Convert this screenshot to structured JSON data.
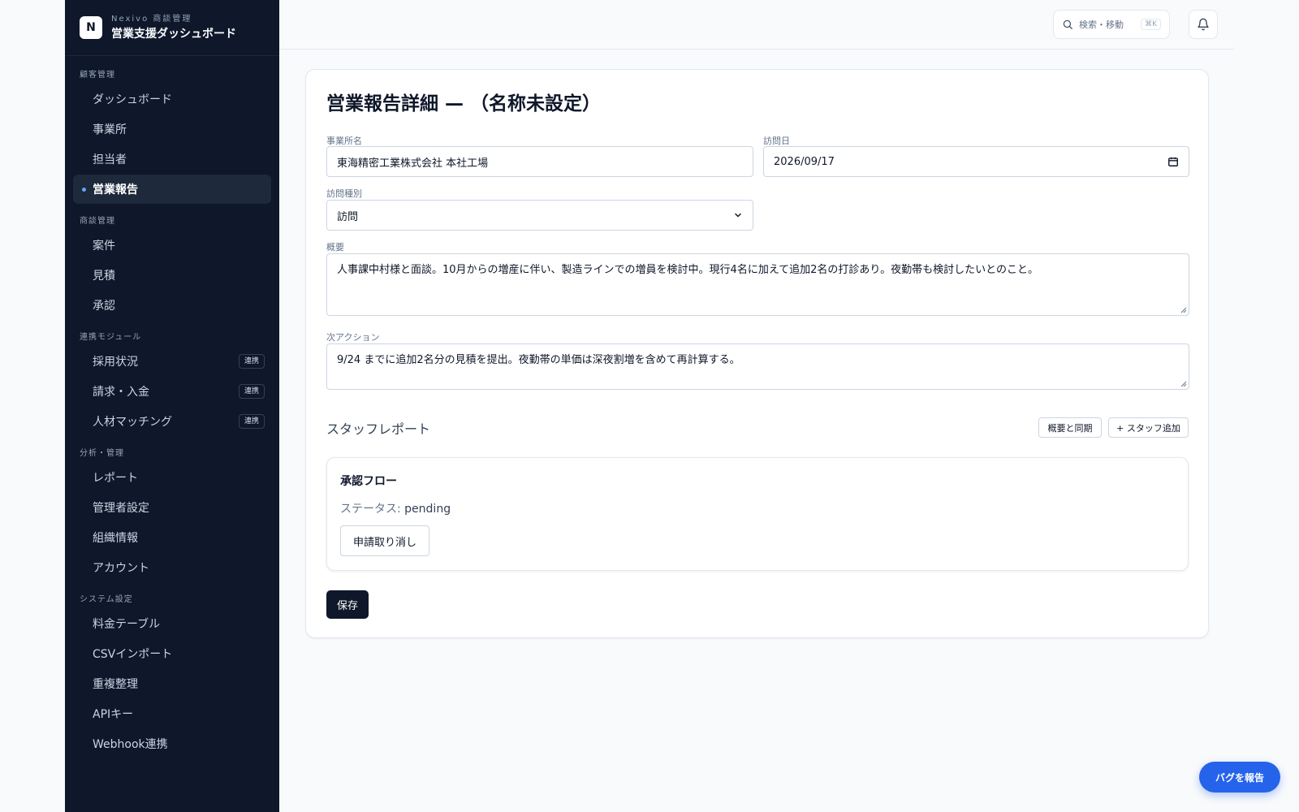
{
  "brand": {
    "logo": "N",
    "subtitle": "Nexivo 商談管理",
    "title": "営業支援ダッシュボード"
  },
  "sidebar": {
    "groups": [
      {
        "label": "顧客管理",
        "items": [
          {
            "label": "ダッシュボード"
          },
          {
            "label": "事業所"
          },
          {
            "label": "担当者"
          },
          {
            "label": "営業報告",
            "active": true
          }
        ]
      },
      {
        "label": "商談管理",
        "items": [
          {
            "label": "案件"
          },
          {
            "label": "見積"
          },
          {
            "label": "承認"
          }
        ]
      },
      {
        "label": "連携モジュール",
        "items": [
          {
            "label": "採用状況",
            "badge": "連携"
          },
          {
            "label": "請求・入金",
            "badge": "連携"
          },
          {
            "label": "人材マッチング",
            "badge": "連携"
          }
        ]
      },
      {
        "label": "分析・管理",
        "items": [
          {
            "label": "レポート"
          },
          {
            "label": "管理者設定"
          },
          {
            "label": "組織情報"
          },
          {
            "label": "アカウント"
          }
        ]
      },
      {
        "label": "システム設定",
        "items": [
          {
            "label": "料金テーブル"
          },
          {
            "label": "CSVインポート"
          },
          {
            "label": "重複整理"
          },
          {
            "label": "APIキー"
          },
          {
            "label": "Webhook連携"
          }
        ]
      }
    ]
  },
  "topbar": {
    "search_label": "検索・移動",
    "search_shortcut": "⌘K"
  },
  "form": {
    "title": "営業報告詳細 — （名称未設定）",
    "office_label": "事業所名",
    "office_value": "東海精密工業株式会社 本社工場",
    "visit_date_label": "訪問日",
    "visit_date_value": "2026/09/17",
    "visit_type_label": "訪問種別",
    "visit_type_value": "訪問",
    "summary_label": "概要",
    "summary_value": "人事課中村様と面談。10月からの増産に伴い、製造ラインでの増員を検討中。現行4名に加えて追加2名の打診あり。夜勤帯も検討したいとのこと。",
    "next_action_label": "次アクション",
    "next_action_value": "9/24 までに追加2名分の見積を提出。夜勤帯の単価は深夜割増を含めて再計算する。"
  },
  "staff_report": {
    "title": "スタッフレポート",
    "sync_button": "概要と同期",
    "add_button": "+ スタッフ追加"
  },
  "approval": {
    "title": "承認フロー",
    "status_label": "ステータス: ",
    "status_value": "pending",
    "cancel_button": "申請取り消し"
  },
  "save_button": "保存",
  "bug_report_button": "バグを報告",
  "colors": {
    "sidebar_bg": "#0f172a",
    "accent": "#2563eb",
    "primary_button": "#0f172a"
  }
}
